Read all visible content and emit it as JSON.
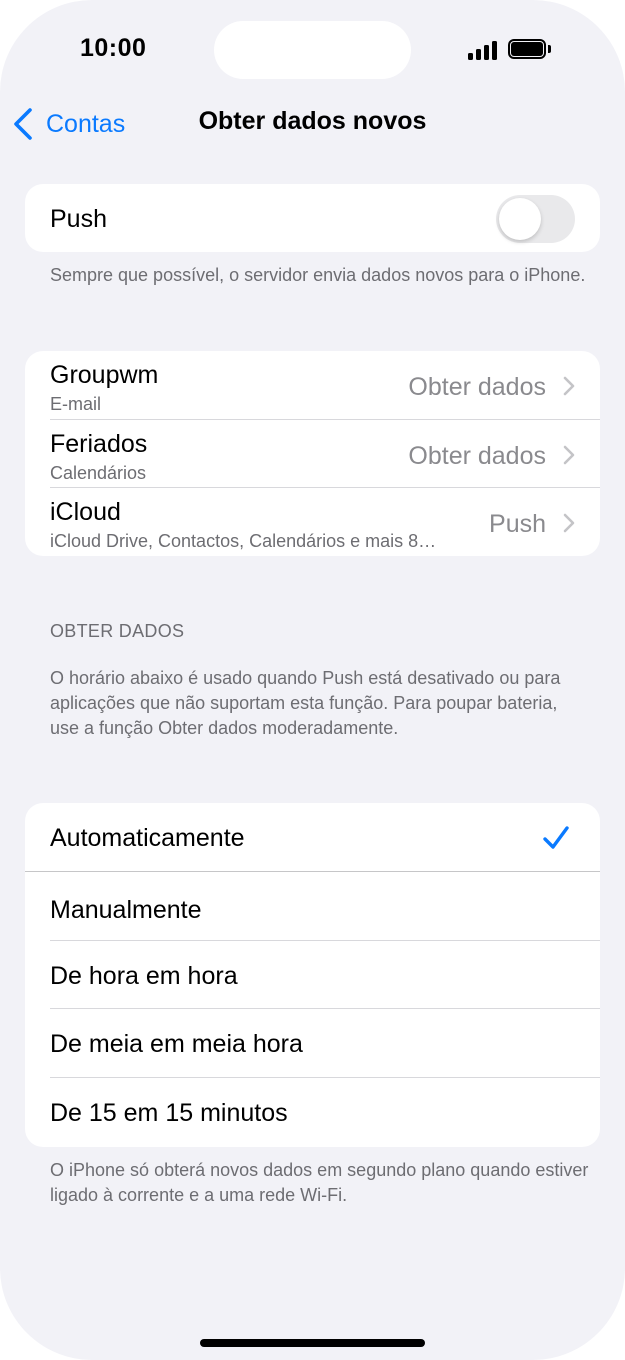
{
  "status_bar": {
    "time": "10:00"
  },
  "nav": {
    "back_label": "Contas",
    "title": "Obter dados novos"
  },
  "push": {
    "label": "Push",
    "enabled": false,
    "footer": "Sempre que possível, o servidor envia dados novos para o iPhone."
  },
  "accounts": [
    {
      "name": "Groupwm",
      "subtitle": "E-mail",
      "value": "Obter dados"
    },
    {
      "name": "Feriados",
      "subtitle": "Calendários",
      "value": "Obter dados"
    },
    {
      "name": "iCloud",
      "subtitle": "iCloud Drive, Contactos, Calendários e mais 8…",
      "value": "Push"
    }
  ],
  "fetch": {
    "header": "OBTER DADOS",
    "description": "O horário abaixo é usado quando Push está desativado ou para aplicações que não suportam esta função. Para poupar bateria, use a função Obter dados moderadamente.",
    "options": [
      {
        "label": "Automaticamente",
        "selected": true
      },
      {
        "label": "Manualmente",
        "selected": false
      },
      {
        "label": "De hora em hora",
        "selected": false
      },
      {
        "label": "De meia em meia hora",
        "selected": false
      },
      {
        "label": "De 15 em 15 minutos",
        "selected": false
      }
    ],
    "footer": "O iPhone só obterá novos dados em segundo plano quando estiver ligado à corrente e a uma rede Wi-Fi."
  },
  "colors": {
    "accent": "#0a7aff",
    "background": "#f2f2f7",
    "secondary_text": "#6d6d72"
  }
}
